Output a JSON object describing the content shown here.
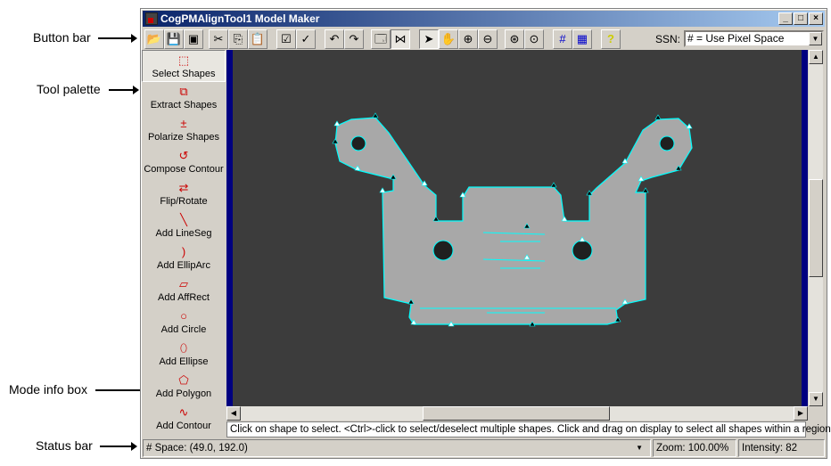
{
  "callouts": {
    "button_bar": "Button bar",
    "tool_palette": "Tool palette",
    "mode_info_box": "Mode info box",
    "status_bar": "Status bar"
  },
  "window": {
    "title": "CogPMAlignTool1 Model Maker",
    "minimize": "_",
    "maximize": "□",
    "close": "×"
  },
  "toolbar": {
    "buttons": [
      {
        "name": "open-icon",
        "glyph": "📂"
      },
      {
        "name": "save-icon",
        "glyph": "💾"
      },
      {
        "name": "save-as-icon",
        "glyph": "▣"
      },
      {
        "name": "cut-icon",
        "glyph": "✂"
      },
      {
        "name": "copy-icon",
        "glyph": "⎘"
      },
      {
        "name": "paste-icon",
        "glyph": "📋"
      },
      {
        "name": "select-all-icon",
        "glyph": "☑"
      },
      {
        "name": "deselect-icon",
        "glyph": "✓"
      },
      {
        "name": "undo-icon",
        "glyph": "↶"
      },
      {
        "name": "redo-icon",
        "glyph": "↷"
      },
      {
        "name": "properties-icon",
        "glyph": "🗔"
      },
      {
        "name": "flip-icon",
        "glyph": "⋈"
      },
      {
        "name": "pointer-icon",
        "glyph": "➤"
      },
      {
        "name": "pan-hand-icon",
        "glyph": "✋"
      },
      {
        "name": "zoom-in-icon",
        "glyph": "⊕"
      },
      {
        "name": "zoom-out-icon",
        "glyph": "⊖"
      },
      {
        "name": "zoom-fit-icon",
        "glyph": "⊛"
      },
      {
        "name": "zoom-1x-icon",
        "glyph": "⊙"
      },
      {
        "name": "grid-icon",
        "glyph": "#"
      },
      {
        "name": "fine-grid-icon",
        "glyph": "▦"
      },
      {
        "name": "help-icon",
        "glyph": "?"
      }
    ],
    "ssn_label": "SSN:",
    "ssn_value": "# = Use Pixel Space"
  },
  "palette": [
    {
      "label": "Select Shapes",
      "icon": "select-shapes-icon",
      "glyph": "⬚",
      "selected": true
    },
    {
      "label": "Extract Shapes",
      "icon": "extract-shapes-icon",
      "glyph": "⧉"
    },
    {
      "label": "Polarize Shapes",
      "icon": "polarize-shapes-icon",
      "glyph": "±"
    },
    {
      "label": "Compose Contour",
      "icon": "compose-contour-icon",
      "glyph": "↺"
    },
    {
      "label": "Flip/Rotate",
      "icon": "flip-rotate-icon",
      "glyph": "⇄"
    },
    {
      "label": "Add LineSeg",
      "icon": "line-segment-icon",
      "glyph": "╲"
    },
    {
      "label": "Add EllipArc",
      "icon": "ellipse-arc-icon",
      "glyph": ")"
    },
    {
      "label": "Add AffRect",
      "icon": "affine-rect-icon",
      "glyph": "▱"
    },
    {
      "label": "Add Circle",
      "icon": "circle-icon",
      "glyph": "○"
    },
    {
      "label": "Add Ellipse",
      "icon": "ellipse-icon",
      "glyph": "⬯"
    },
    {
      "label": "Add Polygon",
      "icon": "polygon-icon",
      "glyph": "⬠"
    },
    {
      "label": "Add Contour",
      "icon": "contour-icon",
      "glyph": "∿"
    }
  ],
  "mode_info": "Click on shape to select. <Ctrl>-click to select/deselect multiple shapes. Click and drag on display to select all shapes within a region.",
  "status": {
    "space": "# Space:  (49.0, 192.0)",
    "zoom": "Zoom:  100.00%",
    "intensity": "Intensity: 82"
  },
  "colors": {
    "outline": "#00ffff",
    "title_start": "#0a246a",
    "title_end": "#a6caf0"
  }
}
